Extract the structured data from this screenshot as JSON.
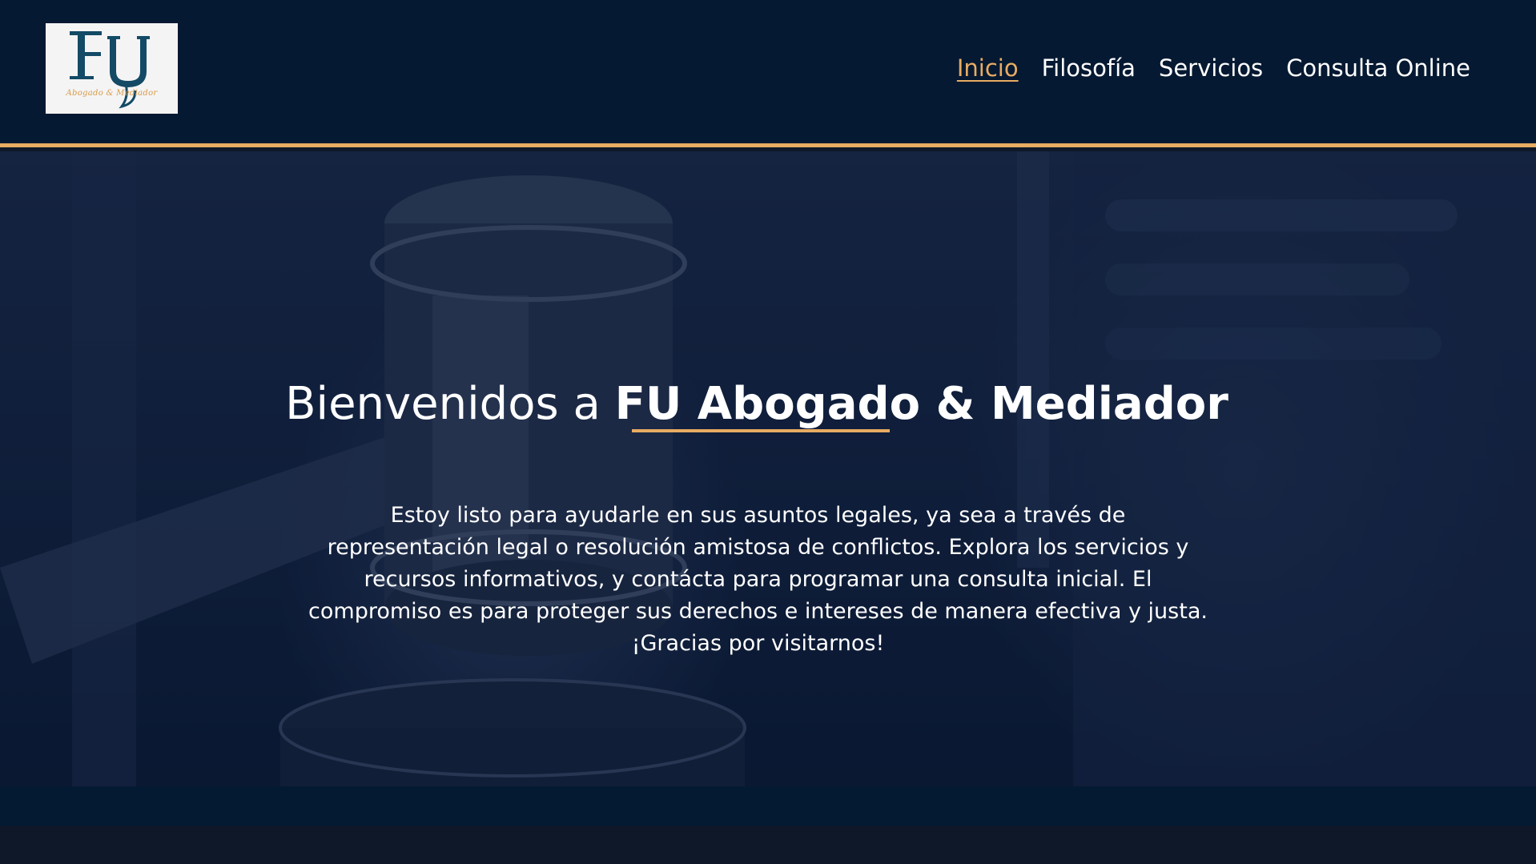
{
  "logo": {
    "monogram": "FU",
    "tagline": "Abogado & Mediador"
  },
  "nav": {
    "items": [
      {
        "label": "Inicio",
        "active": true
      },
      {
        "label": "Filosofía",
        "active": false
      },
      {
        "label": "Servicios",
        "active": false
      },
      {
        "label": "Consulta Online",
        "active": false
      }
    ]
  },
  "hero": {
    "title_prefix": "Bienvenidos a ",
    "title_emphasis": "FU Abogado & Mediador",
    "body": "Estoy listo para ayudarle en sus asuntos legales, ya sea a través de representación legal o resolución amistosa de conflictos. Explora los servicios y recursos informativos, y contácta para programar una consulta inicial. El compromiso es para proteger sus derechos e intereses de manera efectiva y justa. ¡Gracias por visitarnos!"
  },
  "colors": {
    "header_bg": "#061932",
    "accent": "#e8ac62",
    "text": "#ffffff",
    "logo_blue": "#134a66"
  }
}
